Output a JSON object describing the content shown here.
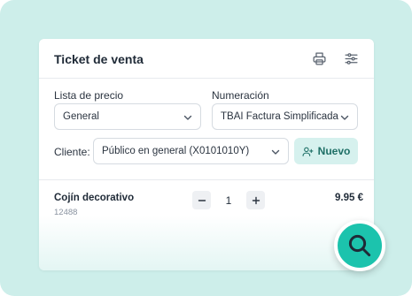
{
  "ticket": {
    "title": "Ticket de venta"
  },
  "form": {
    "price_list_label": "Lista de precio",
    "price_list_value": "General",
    "numbering_label": "Numeración",
    "numbering_value": "TBAI Factura Simplificada",
    "client_label": "Cliente:",
    "client_value": "Público en general (X0101010Y)",
    "new_button_label": "Nuevo"
  },
  "items": [
    {
      "name": "Cojín decorativo",
      "code": "12488",
      "quantity": "1",
      "price": "9.95 €"
    }
  ],
  "icons": {
    "print": "printer-icon",
    "settings": "sliders-icon",
    "chevron": "chevron-down-icon",
    "add_user": "user-plus-icon",
    "search": "search-icon"
  },
  "colors": {
    "frame_background": "#cdeeea",
    "accent": "#1cc3ad",
    "new_button_bg": "#d6f1ee",
    "new_button_text": "#1e6f66"
  }
}
